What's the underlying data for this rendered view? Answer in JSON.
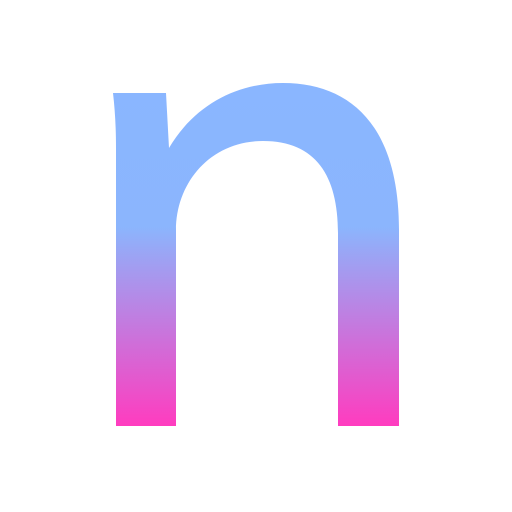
{
  "logo": {
    "glyph": "n",
    "colors": {
      "gradient_top": "#8ab6ff",
      "gradient_mid": "#8bb5fd",
      "gradient_bottom": "#ff3cbf",
      "background": "#ffffff"
    }
  }
}
